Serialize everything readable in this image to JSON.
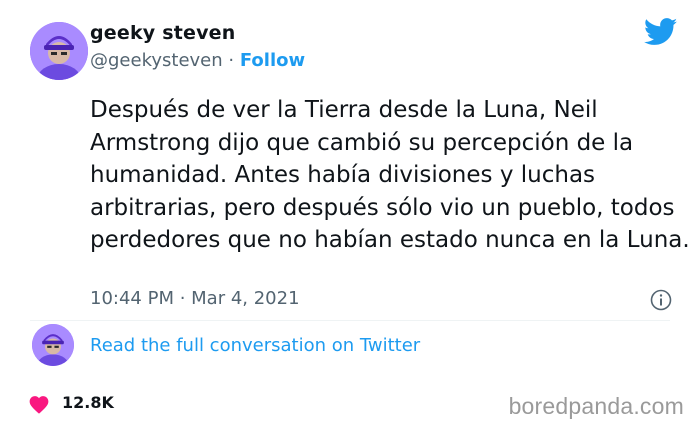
{
  "author": {
    "display_name": "geeky steven",
    "handle": "@geekysteven",
    "separator": "·",
    "follow_label": "Follow",
    "avatar_icon": "avatar-icon"
  },
  "brand": {
    "logo_icon": "twitter-bird-icon",
    "accent_color": "#1d9bf0"
  },
  "tweet": {
    "text": "Después de ver la Tierra desde la Luna, Neil Armstrong dijo que cambió su percepción de la humanidad. Antes había divisiones y luchas arbitrarias, pero después sólo vio un pueblo, todos perdedores que no habían estado nunca en la Luna.",
    "timestamp": "10:44 PM · Mar 4, 2021",
    "info_icon": "info-icon"
  },
  "conversation": {
    "link_text": "Read the full conversation on Twitter"
  },
  "stats": {
    "likes": "12.8K",
    "like_icon": "heart-icon",
    "like_color": "#f91880"
  },
  "watermark": {
    "text": "boredpanda.com"
  }
}
